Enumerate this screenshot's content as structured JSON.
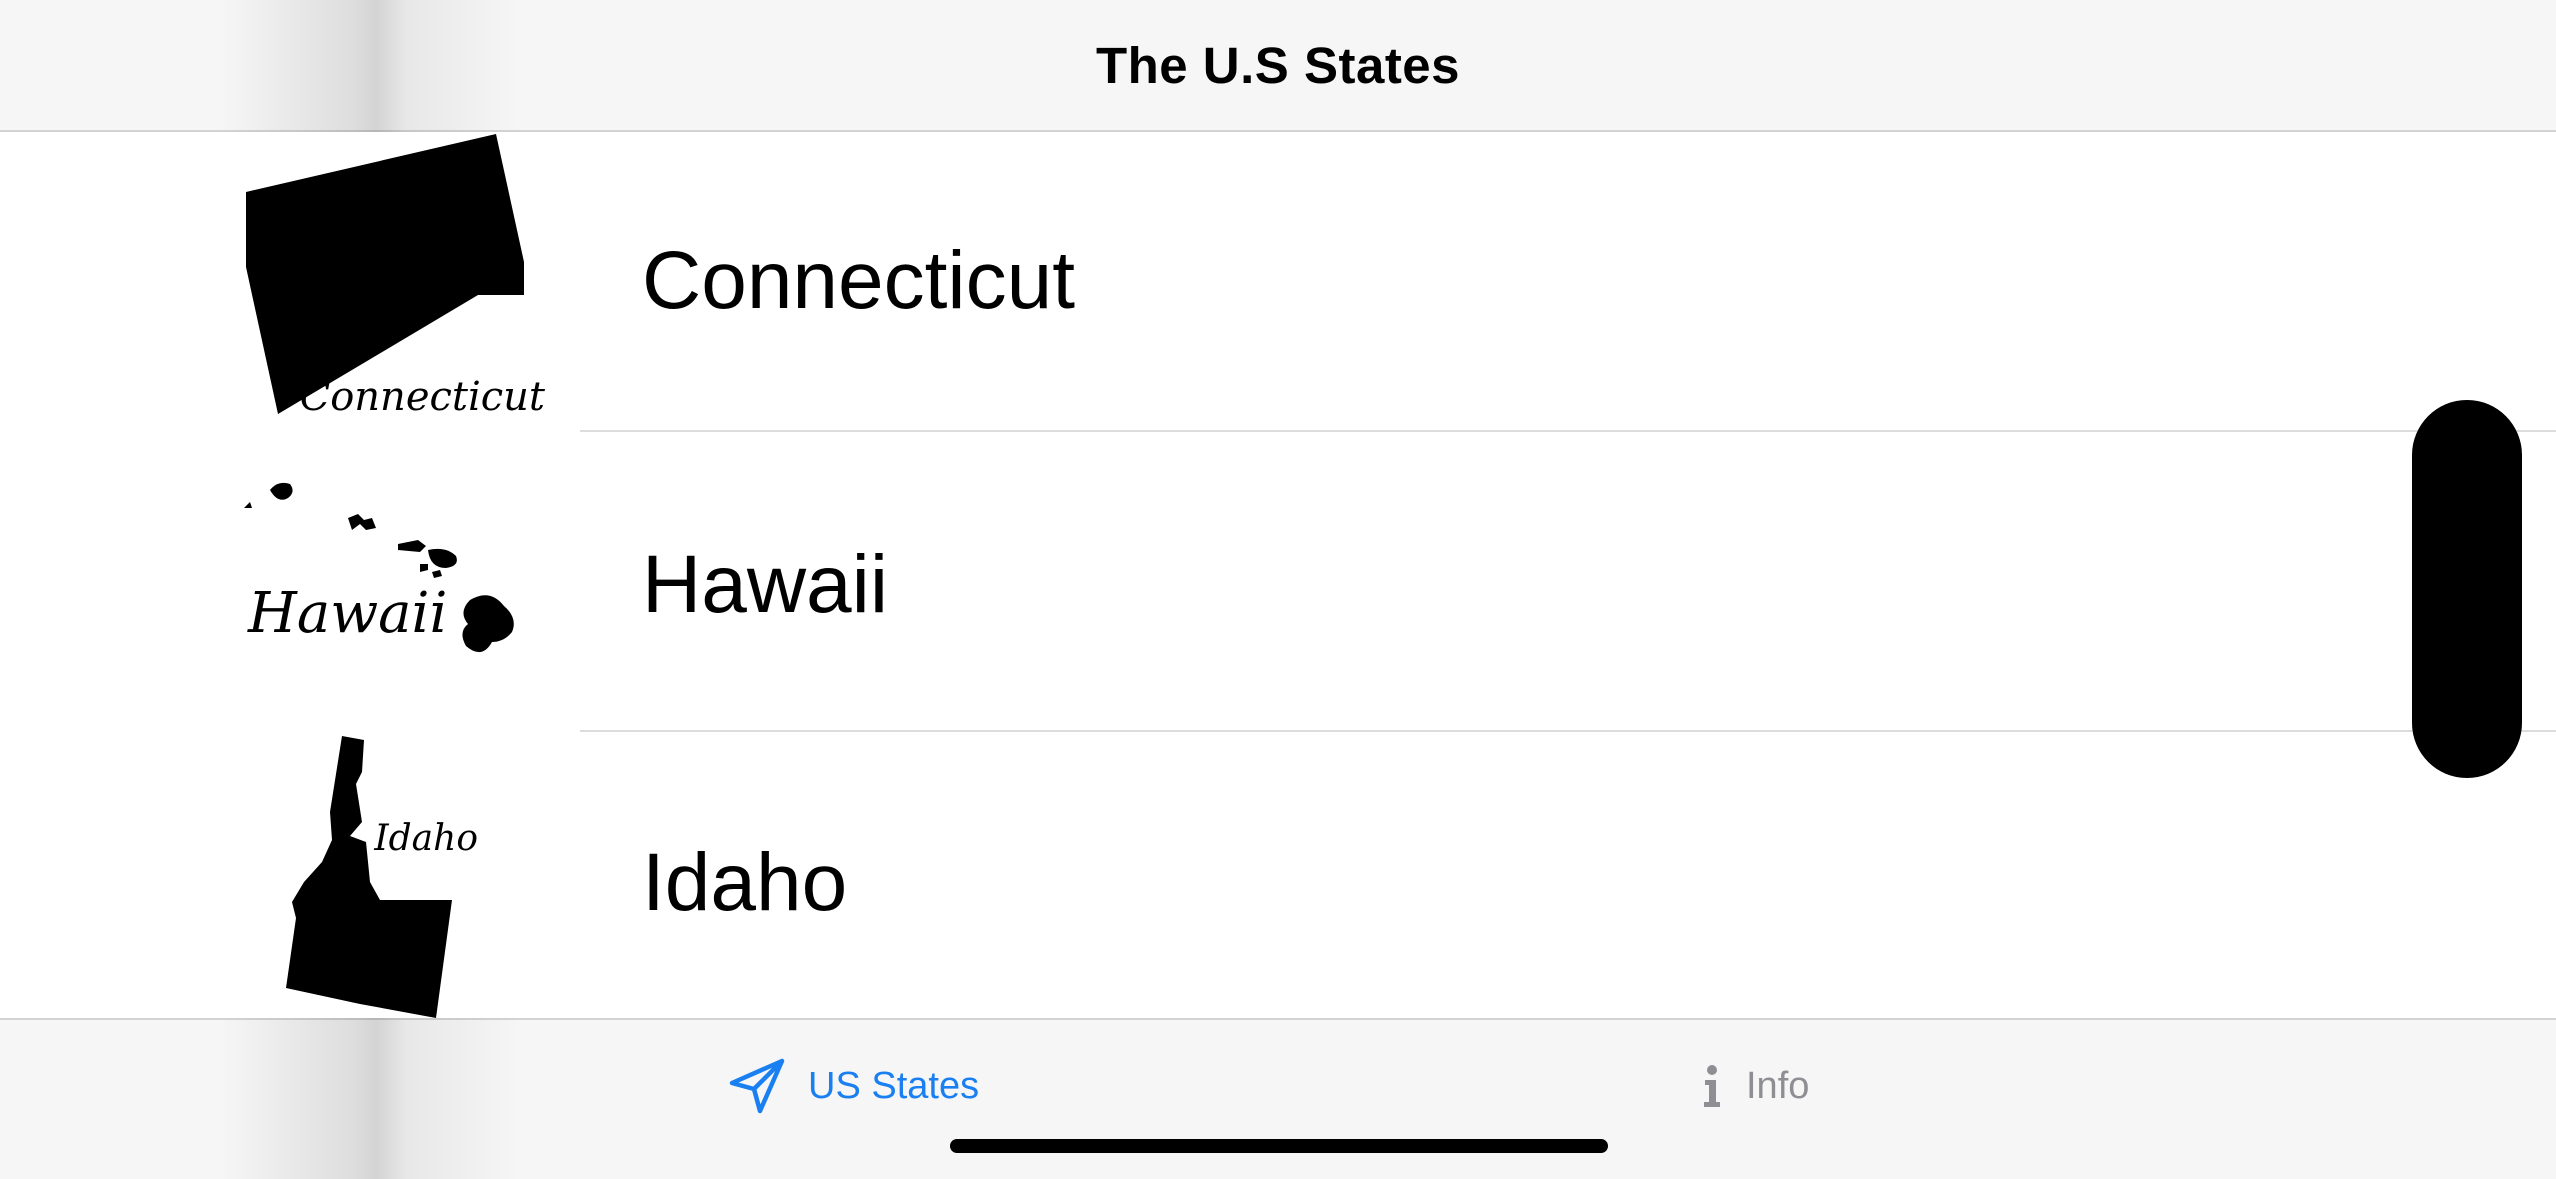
{
  "nav": {
    "title": "The U.S States"
  },
  "states": [
    {
      "name": "Connecticut",
      "map_caption": "Connecticut",
      "map_icon": "connecticut-map-icon"
    },
    {
      "name": "Hawaii",
      "map_caption": "Hawaii",
      "map_icon": "hawaii-map-icon"
    },
    {
      "name": "Idaho",
      "map_caption": "Idaho",
      "map_icon": "idaho-map-icon"
    }
  ],
  "tabs": [
    {
      "label": "US States",
      "icon": "paper-plane-icon",
      "selected": true,
      "color": "#1a7ff0"
    },
    {
      "label": "Info",
      "icon": "info-icon",
      "selected": false,
      "color": "#8e8e93"
    }
  ],
  "colors": {
    "accent": "#1a7ff0",
    "inactive": "#8e8e93",
    "bar_background": "#f6f6f6"
  }
}
